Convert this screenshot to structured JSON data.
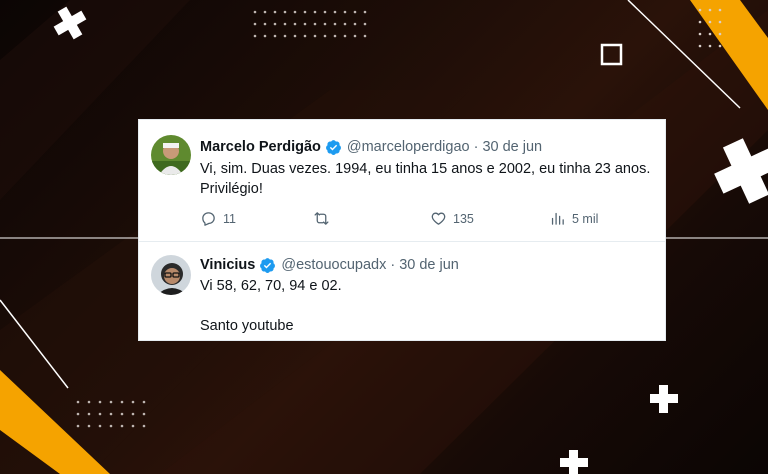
{
  "colors": {
    "accent_orange": "#f5a300",
    "background_dark": "#120906",
    "verified_blue": "#1d9bf0",
    "text_primary": "#0f1419",
    "text_secondary": "#536471"
  },
  "tweets": [
    {
      "author_name": "Marcelo Perdigão",
      "handle": "@marceloperdigao",
      "separator": "·",
      "date": "30 de jun",
      "text": "Vi, sim. Duas vezes. 1994, eu tinha 15 anos e 2002, eu tinha 23 anos. Privilégio!",
      "actions": {
        "reply_count": "11",
        "retweet_count": "",
        "like_count": "135",
        "views_count": "5 mil"
      },
      "icons": [
        "reply-icon",
        "retweet-icon",
        "like-icon",
        "views-icon",
        "verified-badge-icon"
      ]
    },
    {
      "author_name": "Vinicius",
      "handle": "@estouocupadx",
      "separator": "·",
      "date": "30 de jun",
      "text": "Vi 58, 62, 70, 94 e 02.\n\nSanto youtube",
      "icons": [
        "verified-badge-icon"
      ]
    }
  ]
}
